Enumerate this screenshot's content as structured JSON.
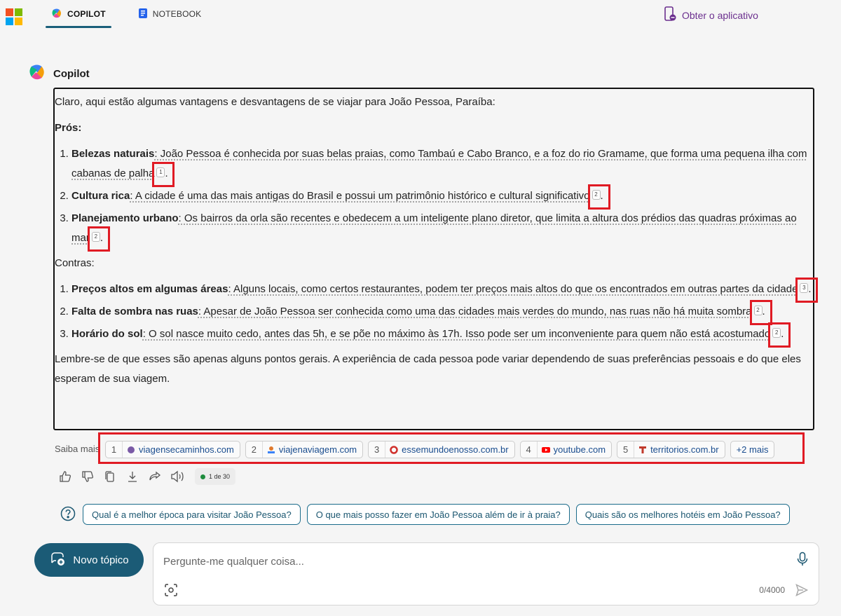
{
  "header": {
    "tabs": [
      {
        "label": "COPILOT",
        "icon": "copilot-icon",
        "active": true
      },
      {
        "label": "NOTEBOOK",
        "icon": "notebook-icon",
        "active": false
      }
    ],
    "get_app": "Obter o aplicativo"
  },
  "assistant": {
    "name": "Copilot"
  },
  "response": {
    "intro": "Claro, aqui estão algumas vantagens e desvantagens de se viajar para João Pessoa, Paraíba:",
    "pros_title": "Prós:",
    "pros": [
      {
        "title": "Belezas naturais",
        "text": ": João Pessoa é conhecida por suas belas praias, como Tambaú e Cabo Branco, e a foz do rio Gramame, que forma uma pequena ilha com cabanas de palha",
        "cite": "1"
      },
      {
        "title": "Cultura rica",
        "text": ": A cidade é uma das mais antigas do Brasil e possui um patrimônio histórico e cultural significativo",
        "cite": "2"
      },
      {
        "title": "Planejamento urbano",
        "text": ": Os bairros da orla são recentes e obedecem a um inteligente plano diretor, que limita a altura dos prédios das quadras próximas ao mar",
        "cite": "2"
      }
    ],
    "cons_title": "Contras:",
    "cons": [
      {
        "title": "Preços altos em algumas áreas",
        "text": ": Alguns locais, como certos restaurantes, podem ter preços mais altos do que os encontrados em outras partes da cidade",
        "cite": "3"
      },
      {
        "title": "Falta de sombra nas ruas",
        "text": ": Apesar de João Pessoa ser conhecida como uma das cidades mais verdes do mundo, nas ruas não há muita sombra",
        "cite": "2"
      },
      {
        "title": "Horário do sol",
        "text": ": O sol nasce muito cedo, antes das 5h, e se põe no máximo às 17h. Isso pode ser um inconveniente para quem não está acostumado",
        "cite": "2"
      }
    ],
    "closing": "Lembre-se de que esses são apenas alguns pontos gerais. A experiência de cada pessoa pode variar dependendo de suas preferências pessoais e do que eles esperam de sua viagem."
  },
  "sources": {
    "label": "Saiba mais",
    "items": [
      {
        "num": "1",
        "domain": "viagensecaminhos.com",
        "color": "#7a5aa6"
      },
      {
        "num": "2",
        "domain": "viajenaviagem.com",
        "color": "#e07a2e"
      },
      {
        "num": "3",
        "domain": "essemundoenosso.com.br",
        "color": "#d0312d"
      },
      {
        "num": "4",
        "domain": "youtube.com",
        "color": "#ff0000"
      },
      {
        "num": "5",
        "domain": "territorios.com.br",
        "color": "#c0392b"
      }
    ],
    "more": "+2 mais"
  },
  "actions": {
    "icons": [
      "thumbs-up-icon",
      "thumbs-down-icon",
      "copy-icon",
      "download-icon",
      "share-icon",
      "speaker-icon"
    ],
    "counter": "1 de 30"
  },
  "suggestions": [
    "Qual é a melhor época para visitar João Pessoa?",
    "O que mais posso fazer em João Pessoa além de ir à praia?",
    "Quais são os melhores hotéis em João Pessoa?"
  ],
  "composer": {
    "new_topic": "Novo tópico",
    "placeholder": "Pergunte-me qualquer coisa...",
    "char_count": "0/4000"
  },
  "colors": {
    "accent": "#1b5b76",
    "highlight": "#e01b24",
    "link": "#6b2f8e"
  }
}
